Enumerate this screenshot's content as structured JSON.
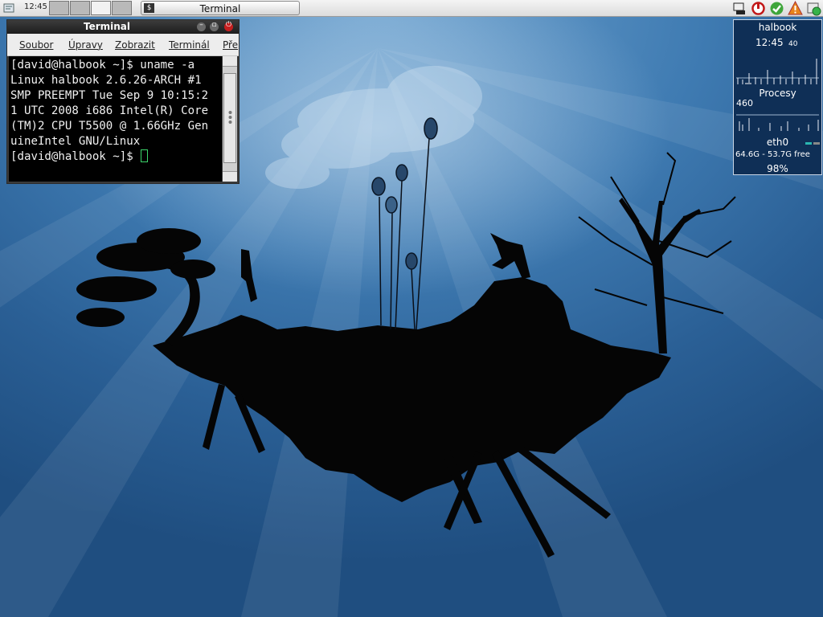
{
  "panel": {
    "clock": "12:45",
    "workspaces": [
      false,
      false,
      true,
      false
    ],
    "task": {
      "icon_glyph": "$",
      "label": "Terminal"
    },
    "tray_icons": [
      "network-icon",
      "power-icon",
      "update-icon",
      "warning-icon",
      "status-icon"
    ]
  },
  "terminal": {
    "title": "Terminal",
    "menu": [
      "Soubor",
      "Úpravy",
      "Zobrazit",
      "Terminál",
      "Pře"
    ],
    "lines": [
      "[david@halbook ~]$ uname -a",
      "Linux halbook 2.6.26-ARCH #1",
      "SMP PREEMPT Tue Sep 9 10:15:2",
      "1 UTC 2008 i686 Intel(R) Core",
      "(TM)2 CPU T5500 @ 1.66GHz Gen",
      "uineIntel GNU/Linux"
    ],
    "prompt": "[david@halbook ~]$ "
  },
  "sysmon": {
    "hostname": "halbook",
    "time": "12:45",
    "seconds": "40",
    "processes_label": "Procesy",
    "process_count": "460",
    "interface": "eth0",
    "disk": "64.6G - 53.7G free",
    "battery": "98%"
  },
  "colors": {
    "panel": "#e6e6e6",
    "terminal_bg": "#000000",
    "cursor": "#3bd46a",
    "widget_bg": "#0f2f56",
    "close_button": "#c41e1e"
  }
}
